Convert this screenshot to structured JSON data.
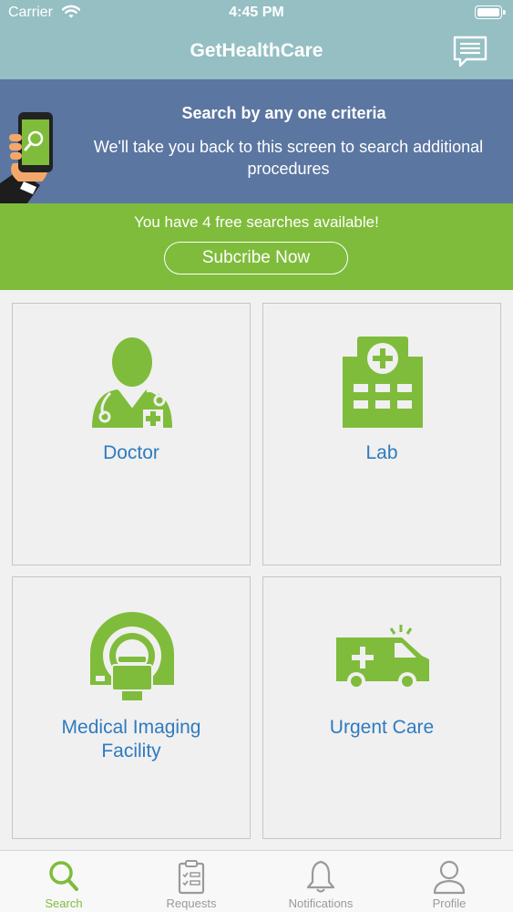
{
  "status_bar": {
    "carrier": "Carrier",
    "time": "4:45 PM"
  },
  "nav": {
    "title": "GetHealthCare",
    "chat_icon": "chat-bubble-icon"
  },
  "info_banner": {
    "heading": "Search by any one criteria",
    "description": "We'll take you back to this screen to search additional procedures"
  },
  "promo": {
    "message": "You have 4 free searches available!",
    "button_label": "Subcribe Now"
  },
  "categories": [
    {
      "label": "Doctor",
      "icon": "doctor-icon"
    },
    {
      "label": "Lab",
      "icon": "hospital-icon"
    },
    {
      "label": "Medical Imaging Facility",
      "icon": "mri-scanner-icon"
    },
    {
      "label": "Urgent Care",
      "icon": "ambulance-icon"
    }
  ],
  "tabs": [
    {
      "label": "Search",
      "icon": "search-icon",
      "active": true
    },
    {
      "label": "Requests",
      "icon": "clipboard-icon",
      "active": false
    },
    {
      "label": "Notifications",
      "icon": "bell-icon",
      "active": false
    },
    {
      "label": "Profile",
      "icon": "user-icon",
      "active": false
    }
  ],
  "colors": {
    "nav_bg": "#95bfc3",
    "banner_bg": "#5b76a1",
    "promo_bg": "#7fbc3b",
    "icon_green": "#7fbc3b",
    "label_blue": "#2f7bbf"
  }
}
